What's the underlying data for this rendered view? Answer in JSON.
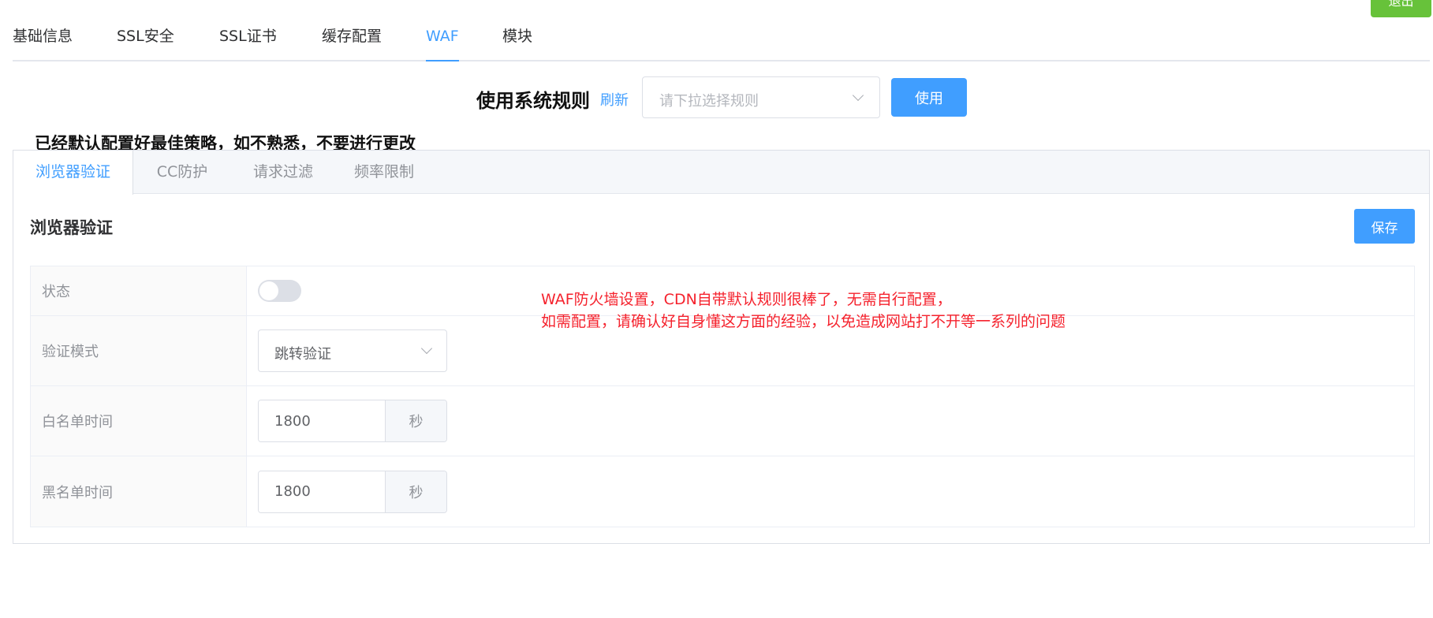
{
  "header": {
    "exit_label": "退出"
  },
  "top_tabs": [
    {
      "label": "基础信息",
      "active": false
    },
    {
      "label": "SSL安全",
      "active": false
    },
    {
      "label": "SSL证书",
      "active": false
    },
    {
      "label": "缓存配置",
      "active": false
    },
    {
      "label": "WAF",
      "active": true
    },
    {
      "label": "模块",
      "active": false
    }
  ],
  "rules": {
    "title": "使用系统规则",
    "refresh_label": "刷新",
    "select_placeholder": "请下拉选择规则",
    "use_label": "使用"
  },
  "warning_text": "已经默认配置好最佳策略，如不熟悉，不要进行更改",
  "waf_tabs": [
    {
      "label": "浏览器验证",
      "active": true
    },
    {
      "label": "CC防护",
      "active": false
    },
    {
      "label": "请求过滤",
      "active": false
    },
    {
      "label": "频率限制",
      "active": false
    }
  ],
  "section": {
    "title": "浏览器验证",
    "save_label": "保存"
  },
  "form": {
    "status_label": "状态",
    "status_on": false,
    "mode_label": "验证模式",
    "mode_value": "跳转验证",
    "whitelist_label": "白名单时间",
    "whitelist_value": "1800",
    "whitelist_unit": "秒",
    "blacklist_label": "黑名单时间",
    "blacklist_value": "1800",
    "blacklist_unit": "秒"
  },
  "notice": {
    "line1": "WAF防火墙设置，CDN自带默认规则很棒了，无需自行配置，",
    "line2": "如需配置，请确认好自身懂这方面的经验，以免造成网站打不开等一系列的问题"
  },
  "colors": {
    "primary": "#409eff",
    "success": "#67c23a",
    "danger": "#f5222d"
  }
}
